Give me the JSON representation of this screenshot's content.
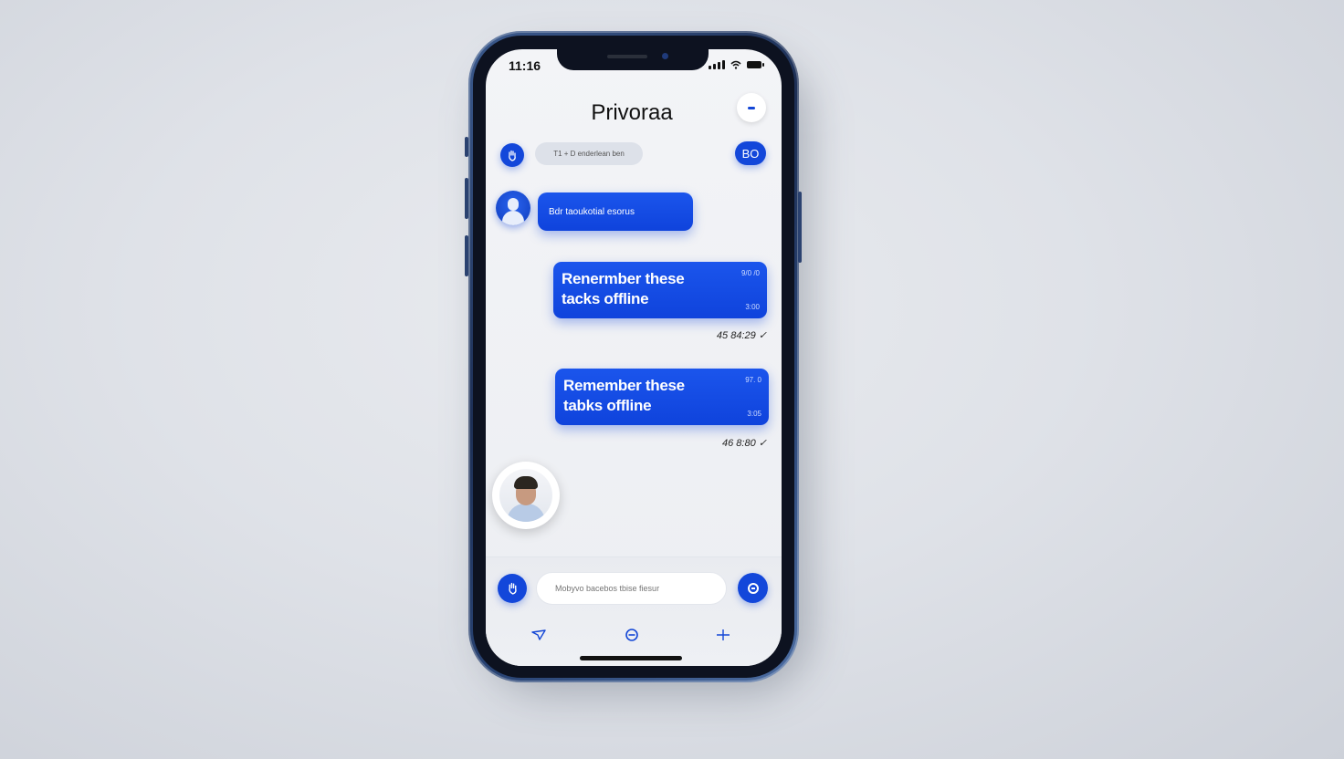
{
  "status_bar": {
    "time": "11:16"
  },
  "header": {
    "title": "Privoraa",
    "menu_icon": "menu-dots-icon"
  },
  "toolbar": {
    "left_icon": "hand-icon",
    "chip_label": "T1 + D enderlean ben",
    "counter_label": "BO"
  },
  "messages": [
    {
      "type": "incoming",
      "text": "Bdr taoukotial esorus"
    },
    {
      "type": "outgoing",
      "text": "Renermber these tacks offline",
      "meta_top": "9/0 /0",
      "meta_bottom": "3:00",
      "timestamp": "45  84:29 ✓"
    },
    {
      "type": "outgoing",
      "text": "Remember these tabks offline",
      "meta_top": "97. 0",
      "meta_bottom": "3:05",
      "timestamp": "46  8:80 ✓"
    }
  ],
  "composer": {
    "placeholder": "Mobyvo bacebos tbise fiesur",
    "attach_icon": "hand-icon",
    "send_icon": "send-icon"
  },
  "bottom_nav": [
    "paper-plane-icon",
    "chat-icon",
    "plus-icon"
  ],
  "colors": {
    "accent": "#1347da",
    "background": "#eceef2"
  }
}
